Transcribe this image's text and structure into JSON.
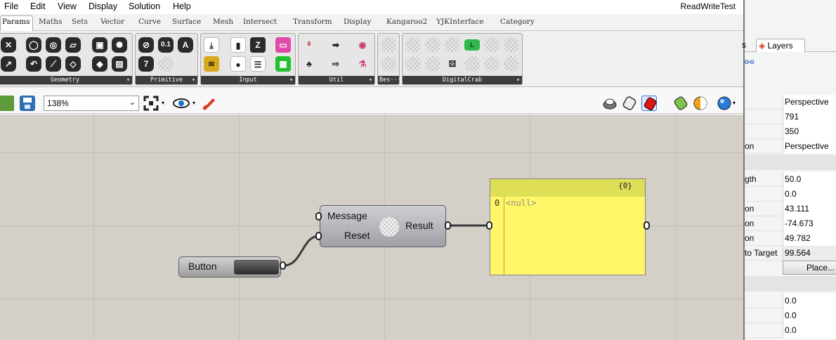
{
  "menu": {
    "items": [
      "File",
      "Edit",
      "View",
      "Display",
      "Solution",
      "Help"
    ],
    "window_title": "ReadWriteTest"
  },
  "tabs": [
    "Params",
    "Maths",
    "Sets",
    "Vector",
    "Curve",
    "Surface",
    "Mesh",
    "Intersect",
    "Transform",
    "Display",
    "Kangaroo2",
    "YJKInterface",
    "Category"
  ],
  "ribbon": {
    "panels": [
      "Geometry",
      "Primitive",
      "Input",
      "Util",
      "Bes···",
      "DigitalCrab"
    ],
    "primitive_icon_labels": [
      "0.1",
      "A",
      "7"
    ]
  },
  "toolbar": {
    "zoom_value": "138%",
    "icons": [
      "open-icon",
      "save-icon",
      "zoom-extents-icon",
      "eye-icon",
      "sketch-pen-icon",
      "preview-wire-icon",
      "preview-shaded-icon",
      "preview-selected-icon",
      "preview-mesh-icon",
      "preview-color-icon",
      "sphere-icon"
    ]
  },
  "canvas": {
    "button_node": {
      "label": "Button"
    },
    "component": {
      "inputs": [
        "Message",
        "Reset"
      ],
      "output": "Result"
    },
    "panel_node": {
      "path": "{0}",
      "index": "0",
      "value": "<null>"
    }
  },
  "right_panel": {
    "tabs": {
      "left_partial": "s",
      "active": "Layers"
    },
    "properties": [
      {
        "key": "",
        "value": "Perspective"
      },
      {
        "key": "",
        "value": "791"
      },
      {
        "key": "",
        "value": "350"
      },
      {
        "key": "on",
        "value": "Perspective"
      },
      {
        "key": "gth",
        "value": "50.0"
      },
      {
        "key": "",
        "value": "0.0"
      },
      {
        "key": "on",
        "value": "43.111"
      },
      {
        "key": "on",
        "value": "-74.673"
      },
      {
        "key": "on",
        "value": "49.782"
      },
      {
        "key": " to Target",
        "value": "99.564"
      }
    ],
    "place_button": "Place...",
    "location_values": [
      "0.0",
      "0.0",
      "0.0"
    ]
  }
}
